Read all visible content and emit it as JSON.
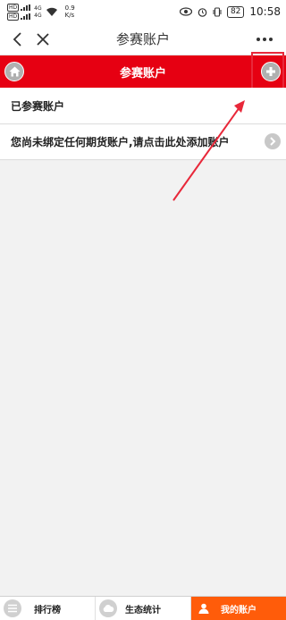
{
  "status_bar": {
    "sim_label_1": "HD",
    "sim_label_2": "HD",
    "net_type_1": "4G",
    "net_type_2": "4G",
    "speed_value": "0.9",
    "speed_unit": "K/s",
    "battery": "82",
    "time": "10:58"
  },
  "title_bar": {
    "title": "参赛账户"
  },
  "header": {
    "title": "参赛账户"
  },
  "list": {
    "joined_label": "已参赛账户",
    "bind_prompt": "您尚未绑定任何期货账户,请点击此处添加账户"
  },
  "tabs": [
    {
      "label": "排行榜",
      "icon": "list-icon"
    },
    {
      "label": "生态统计",
      "icon": "cloud-icon"
    },
    {
      "label": "我的账户",
      "icon": "user-icon"
    }
  ],
  "colors": {
    "header_red": "#e60012",
    "active_tab": "#ff5c0a",
    "annotation": "#e8283a"
  }
}
